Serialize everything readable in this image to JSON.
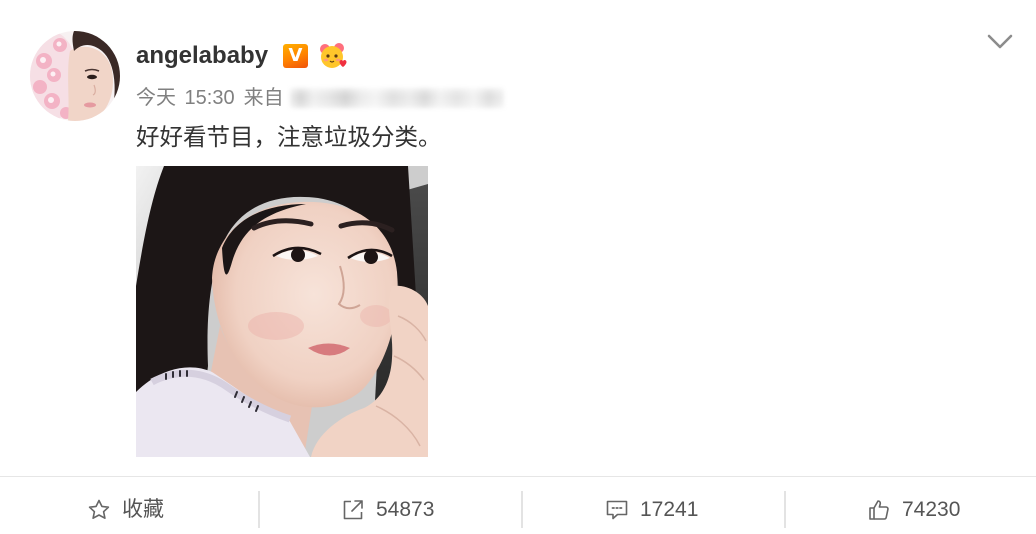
{
  "post": {
    "author": {
      "name": "angelababy",
      "verified_badge": "V"
    },
    "meta": {
      "time": "今天 15:30",
      "source_label": "来自"
    },
    "text": "好好看节目，注意垃圾分类。"
  },
  "icons": {
    "member_badge": "member-badge-icon",
    "menu": "chevron-down-icon"
  },
  "actions": [
    {
      "icon": "star-icon",
      "label": "收藏"
    },
    {
      "icon": "share-icon",
      "label": "54873"
    },
    {
      "icon": "comment-icon",
      "label": "17241"
    },
    {
      "icon": "like-icon",
      "label": "74230"
    }
  ],
  "colors": {
    "text_primary": "#333333",
    "text_meta": "#808080",
    "action_text": "#555555",
    "verified_badge": "#ff8200",
    "divider": "#e6e6e6"
  }
}
